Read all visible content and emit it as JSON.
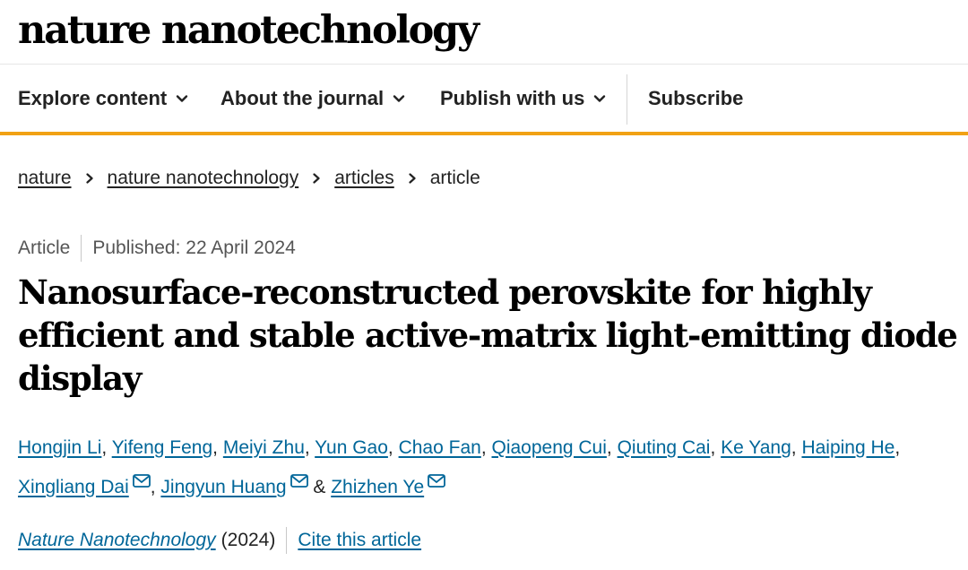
{
  "site": {
    "logo": "nature nanotechnology"
  },
  "nav": {
    "items": [
      {
        "label": "Explore content",
        "icon": "chevron-down-icon"
      },
      {
        "label": "About the journal",
        "icon": "chevron-down-icon"
      },
      {
        "label": "Publish with us",
        "icon": "chevron-down-icon"
      },
      {
        "label": "Subscribe"
      }
    ]
  },
  "breadcrumb": {
    "items": [
      "nature",
      "nature nanotechnology",
      "articles"
    ],
    "current": "article"
  },
  "article": {
    "type": "Article",
    "published": "Published: 22 April 2024",
    "title": "Nanosurface-reconstructed perovskite for highly efficient and stable active-matrix light-emitting diode display",
    "authors": [
      {
        "name": "Hongjin Li"
      },
      {
        "name": "Yifeng Feng"
      },
      {
        "name": "Meiyi Zhu"
      },
      {
        "name": "Yun Gao"
      },
      {
        "name": "Chao Fan"
      },
      {
        "name": "Qiaopeng Cui"
      },
      {
        "name": "Qiuting Cai"
      },
      {
        "name": "Ke Yang"
      },
      {
        "name": "Haiping He"
      },
      {
        "name": "Xingliang Dai",
        "corresponding": true
      },
      {
        "name": "Jingyun Huang",
        "corresponding": true
      },
      {
        "name": "Zhizhen Ye",
        "corresponding": true
      }
    ],
    "separators": {
      "comma": ", ",
      "and": " & "
    },
    "journal": "Nature Nanotechnology",
    "year": "(2024)",
    "cite_label": "Cite this article"
  },
  "colors": {
    "accent": "#f1a114",
    "link": "#006699",
    "text": "#222222"
  }
}
